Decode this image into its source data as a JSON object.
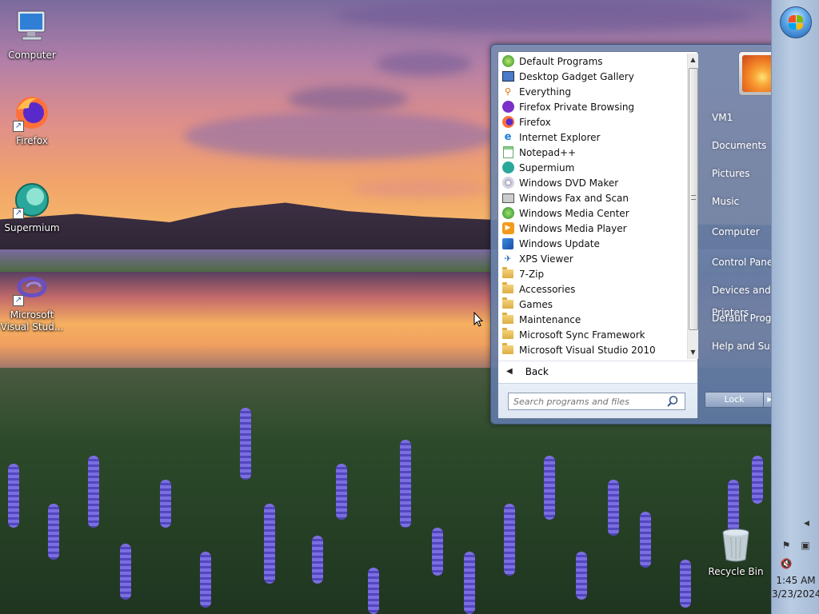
{
  "desktop": {
    "icons": [
      {
        "label": "Computer"
      },
      {
        "label": "Firefox"
      },
      {
        "label": "Supermium"
      },
      {
        "label": "Microsoft Visual Stud..."
      }
    ],
    "recycle_bin": "Recycle Bin"
  },
  "start_menu": {
    "programs": [
      {
        "label": "Default Programs",
        "icon": "default-programs-icon"
      },
      {
        "label": "Desktop Gadget Gallery",
        "icon": "gadget-icon"
      },
      {
        "label": "Everything",
        "icon": "magnifier-icon"
      },
      {
        "label": "Firefox Private Browsing",
        "icon": "mask-icon"
      },
      {
        "label": "Firefox",
        "icon": "firefox-icon"
      },
      {
        "label": "Internet Explorer",
        "icon": "ie-icon"
      },
      {
        "label": "Notepad++",
        "icon": "notepad-icon"
      },
      {
        "label": "Supermium",
        "icon": "supermium-icon"
      },
      {
        "label": "Windows DVD Maker",
        "icon": "dvd-icon"
      },
      {
        "label": "Windows Fax and Scan",
        "icon": "fax-icon"
      },
      {
        "label": "Windows Media Center",
        "icon": "media-center-icon"
      },
      {
        "label": "Windows Media Player",
        "icon": "media-player-icon"
      },
      {
        "label": "Windows Update",
        "icon": "update-icon"
      },
      {
        "label": "XPS Viewer",
        "icon": "xps-icon"
      },
      {
        "label": "7-Zip",
        "icon": "folder-icon"
      },
      {
        "label": "Accessories",
        "icon": "folder-icon"
      },
      {
        "label": "Games",
        "icon": "folder-icon"
      },
      {
        "label": "Maintenance",
        "icon": "folder-icon"
      },
      {
        "label": "Microsoft Sync Framework",
        "icon": "folder-icon"
      },
      {
        "label": "Microsoft Visual Studio 2010",
        "icon": "folder-icon"
      }
    ],
    "back_label": "Back",
    "search_placeholder": "Search programs and files",
    "right_links": [
      "VM1",
      "Documents",
      "Pictures",
      "Music",
      "Computer",
      "Control Panel",
      "Devices and Printers",
      "Default Programs",
      "Help and Support"
    ],
    "lock_label": "Lock"
  },
  "taskbar": {
    "time": "1:45 AM",
    "date": "3/23/2024"
  }
}
